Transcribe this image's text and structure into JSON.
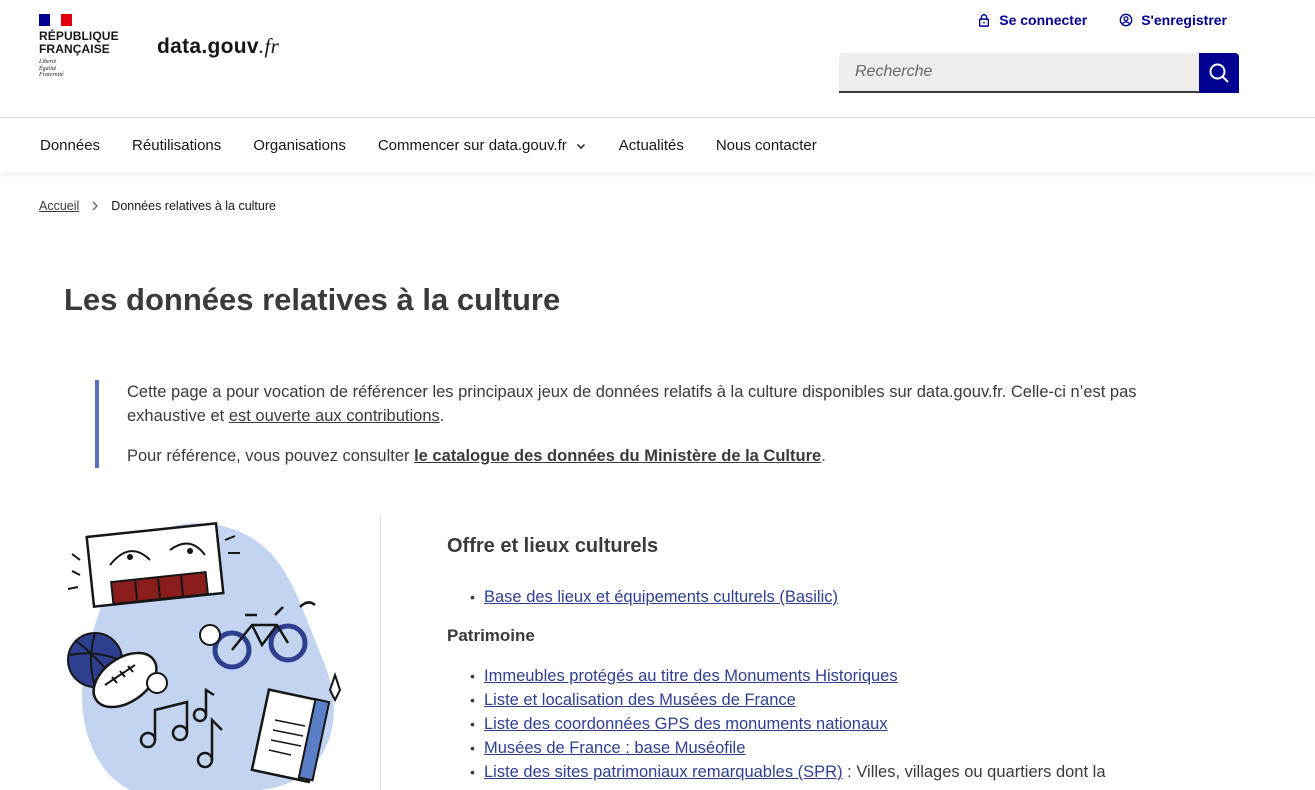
{
  "header": {
    "republic_line1": "RÉPUBLIQUE",
    "republic_line2": "FRANÇAISE",
    "motto": [
      "Liberté",
      "Égalité",
      "Fraternité"
    ],
    "site_name": "data.gouv",
    "site_tld": ".fr",
    "login": "Se connecter",
    "register": "S'enregistrer",
    "search_placeholder": "Recherche"
  },
  "nav": {
    "items": [
      "Données",
      "Réutilisations",
      "Organisations",
      "Commencer sur data.gouv.fr",
      "Actualités",
      "Nous contacter"
    ]
  },
  "breadcrumb": {
    "home": "Accueil",
    "current": "Données relatives à la culture"
  },
  "page": {
    "title": "Les données relatives à la culture",
    "intro_part1": "Cette page a pour vocation de référencer les principaux jeux de données relatifs à la culture disponibles sur data.gouv.fr. Celle-ci n’est pas exhaustive et ",
    "intro_link": "est ouverte aux contributions",
    "intro_part2": ".",
    "ref_part1": "Pour référence, vous pouvez consulter ",
    "ref_link": "le catalogue des données du Ministère de la Culture",
    "ref_part2": "."
  },
  "sections": {
    "offre_title": "Offre et lieux culturels",
    "offre_items": [
      "Base des lieux et équipements culturels (Basilic)"
    ],
    "patrimoine_title": "Patrimoine",
    "patrimoine_items": [
      "Immeubles protégés au titre des Monuments Historiques",
      "Liste et localisation des Musées de France",
      "Liste des coordonnées GPS des monuments nationaux",
      "Musées de France : base Muséofile",
      "Liste des sites patrimoniaux remarquables (SPR)"
    ],
    "spr_suffix": " : Villes, villages ou quartiers dont la"
  },
  "colors": {
    "primary": "#000091",
    "link": "#2f3f8f",
    "callout_border": "#5770be",
    "illus_blob": "#c2d4f0"
  }
}
